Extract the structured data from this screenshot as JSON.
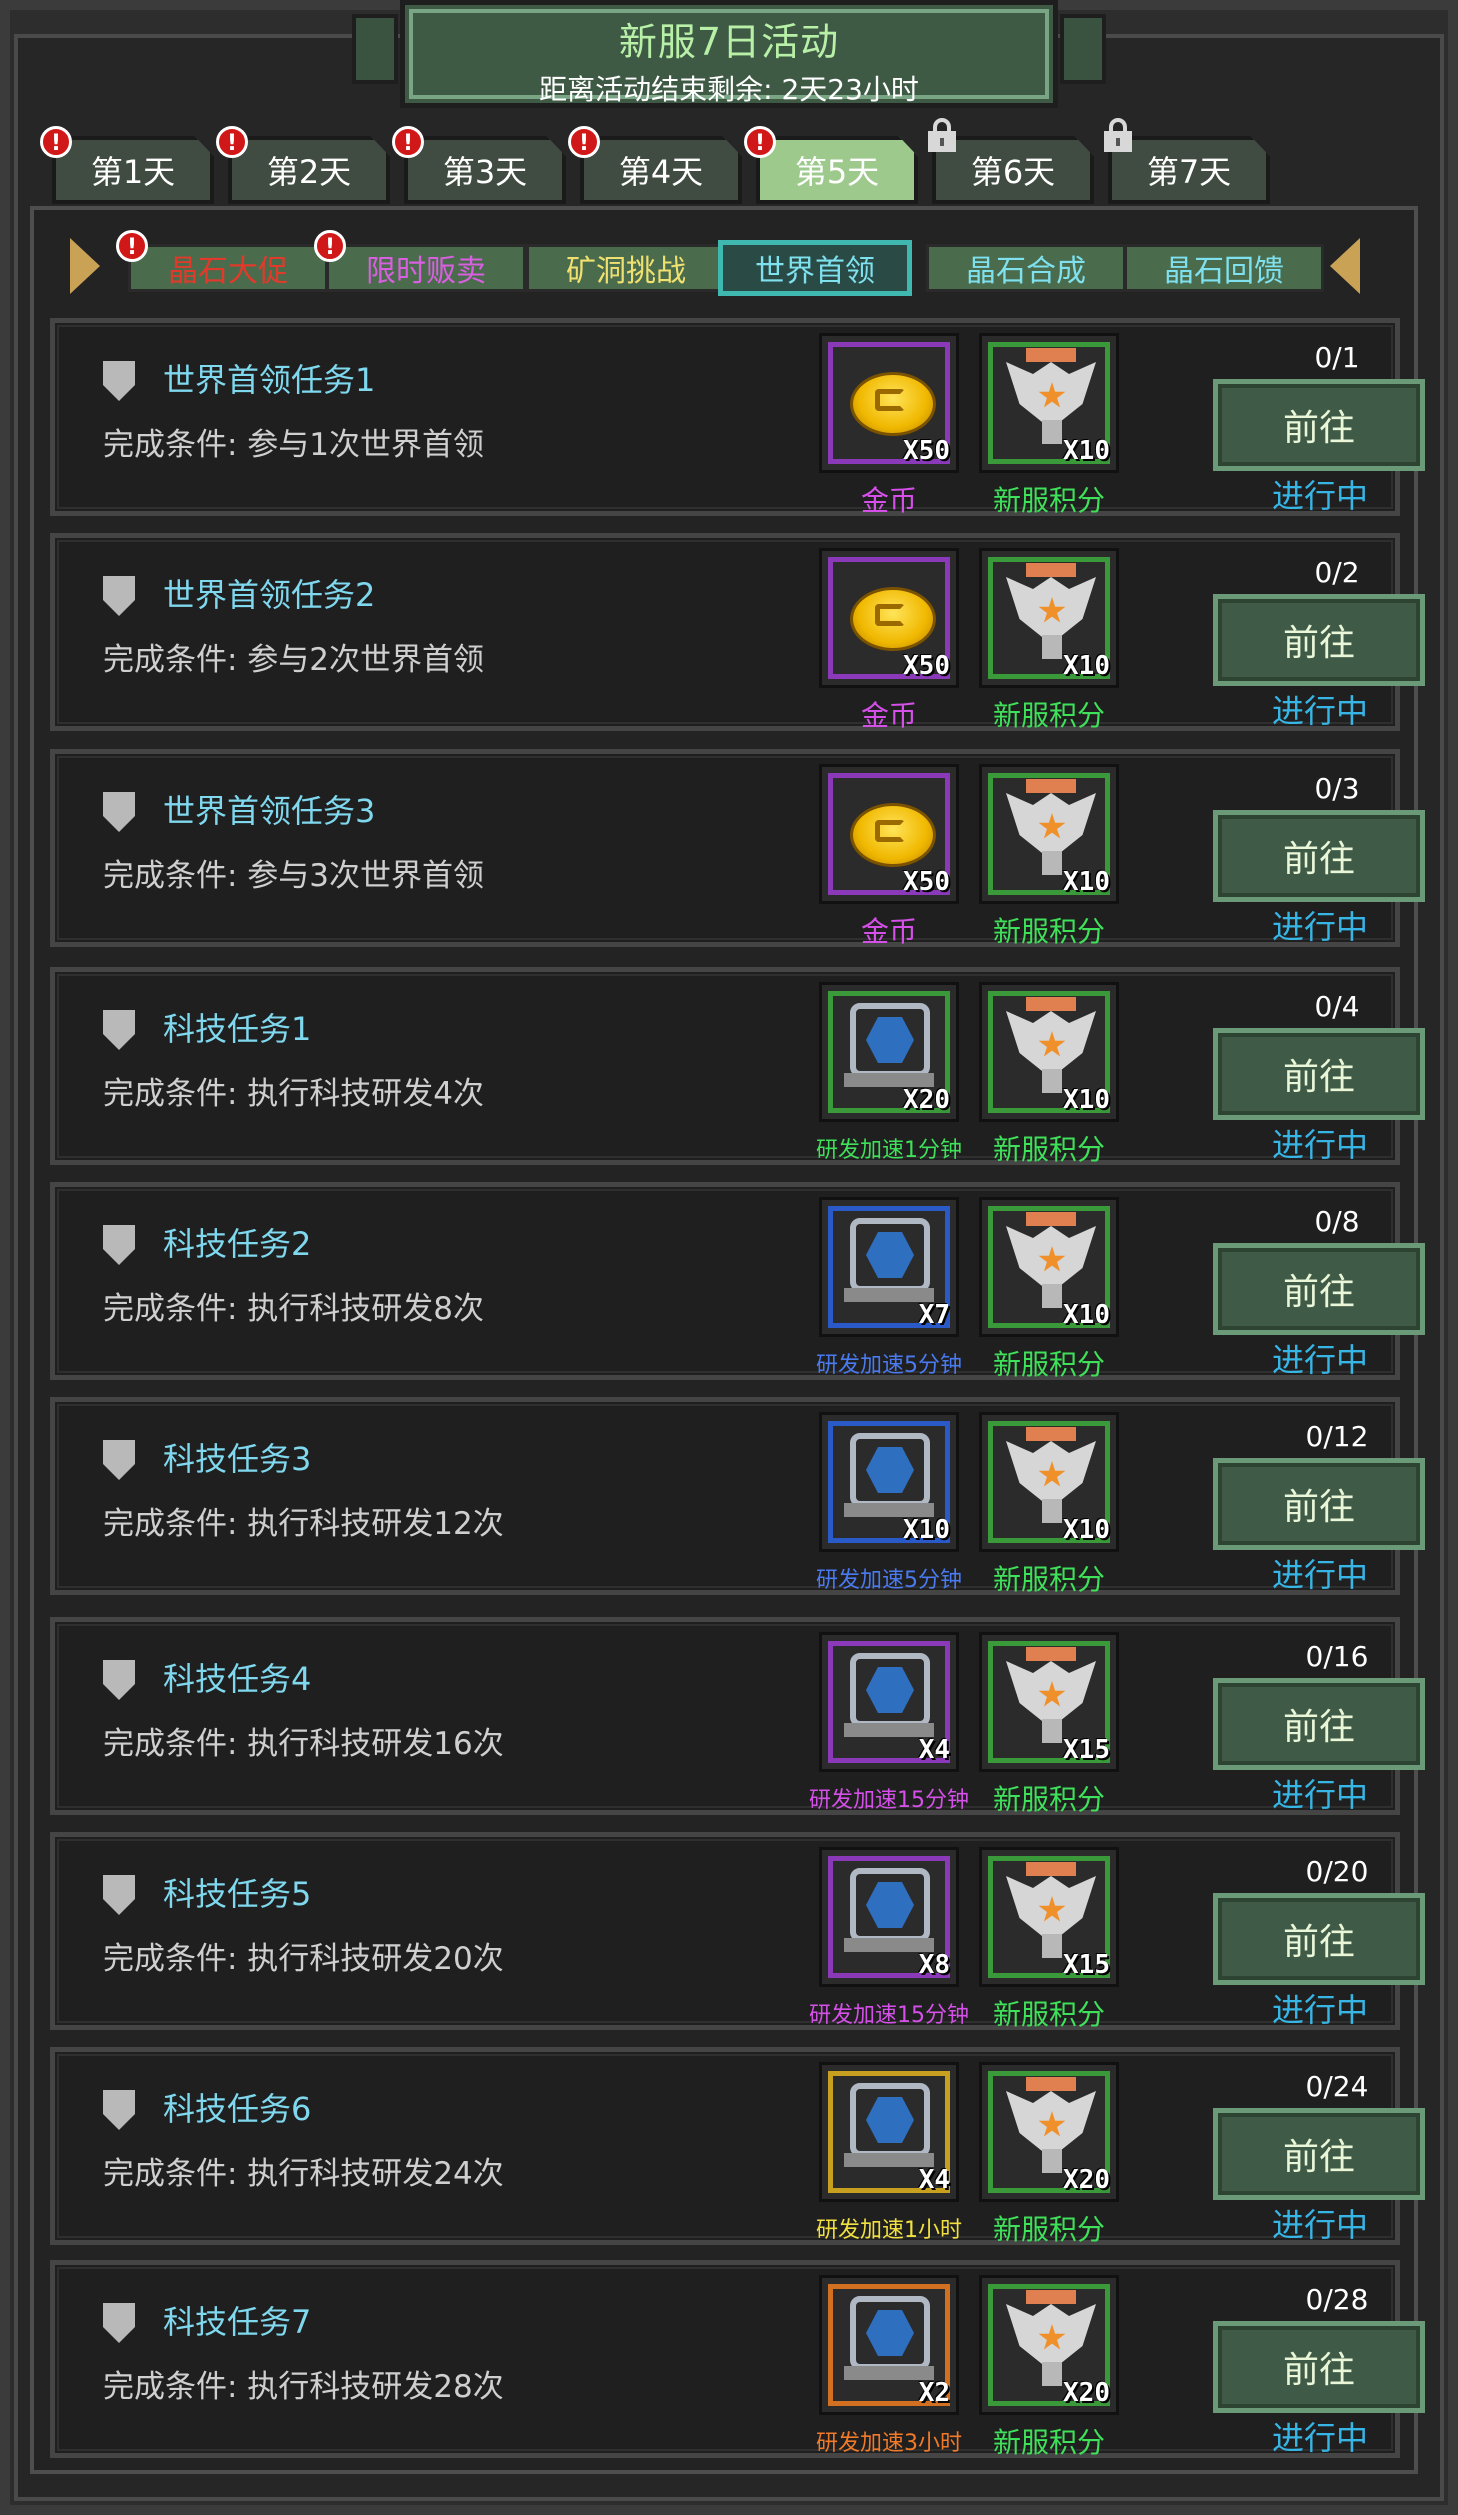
{
  "banner": {
    "title": "新服7日活动",
    "subtitle": "距离活动结束剩余: 2天23小时"
  },
  "days": [
    {
      "label": "第1天",
      "badge": "!",
      "locked": false,
      "active": false
    },
    {
      "label": "第2天",
      "badge": "!",
      "locked": false,
      "active": false
    },
    {
      "label": "第3天",
      "badge": "!",
      "locked": false,
      "active": false
    },
    {
      "label": "第4天",
      "badge": "!",
      "locked": false,
      "active": false
    },
    {
      "label": "第5天",
      "badge": "!",
      "locked": false,
      "active": true
    },
    {
      "label": "第6天",
      "badge": "",
      "locked": true,
      "active": false
    },
    {
      "label": "第7天",
      "badge": "",
      "locked": true,
      "active": false
    }
  ],
  "categories": [
    {
      "label": "晶石大促",
      "color": "#e23a2a",
      "badge": "!"
    },
    {
      "label": "限时贩卖",
      "color": "#d860e0",
      "badge": "!"
    },
    {
      "label": "矿洞挑战",
      "color": "#f0e070",
      "badge": ""
    },
    {
      "label": "世界首领",
      "color": "#7fe0ee",
      "badge": "",
      "active": true
    },
    {
      "label": "晶石合成",
      "color": "#7fe0ee",
      "badge": ""
    },
    {
      "label": "晶石回馈",
      "color": "#7fe0ee",
      "badge": ""
    }
  ],
  "colors": {
    "coin_name": "#d450e8",
    "points_name": "#3fe05a",
    "green_item_name": "#3fe05a",
    "blue_item_name": "#4a7af0",
    "purple_item_name": "#d450e8",
    "gold_item_name": "#f0e040",
    "orange_item_name": "#f07a2a",
    "status": "#37b6e6"
  },
  "tasks": [
    {
      "title": "世界首领任务1",
      "condition": "完成条件: 参与1次世界首领",
      "progress": "0/1",
      "reward1": {
        "icon": "gold-coin-icon",
        "name": "金币",
        "qty": "X50",
        "rarity": "purple"
      },
      "reward2": {
        "icon": "new-server-points-icon",
        "name": "新服积分",
        "qty": "X10"
      },
      "button": "前往",
      "status": "进行中"
    },
    {
      "title": "世界首领任务2",
      "condition": "完成条件: 参与2次世界首领",
      "progress": "0/2",
      "reward1": {
        "icon": "gold-coin-icon",
        "name": "金币",
        "qty": "X50",
        "rarity": "purple"
      },
      "reward2": {
        "icon": "new-server-points-icon",
        "name": "新服积分",
        "qty": "X10"
      },
      "button": "前往",
      "status": "进行中"
    },
    {
      "title": "世界首领任务3",
      "condition": "完成条件: 参与3次世界首领",
      "progress": "0/3",
      "reward1": {
        "icon": "gold-coin-icon",
        "name": "金币",
        "qty": "X50",
        "rarity": "purple"
      },
      "reward2": {
        "icon": "new-server-points-icon",
        "name": "新服积分",
        "qty": "X10"
      },
      "button": "前往",
      "status": "进行中"
    },
    {
      "title": "科技任务1",
      "condition": "完成条件: 执行科技研发4次",
      "progress": "0/4",
      "reward1": {
        "icon": "research-speedup-icon",
        "name": "研发加速1分钟",
        "qty": "X20",
        "rarity": "green"
      },
      "reward2": {
        "icon": "new-server-points-icon",
        "name": "新服积分",
        "qty": "X10"
      },
      "button": "前往",
      "status": "进行中"
    },
    {
      "title": "科技任务2",
      "condition": "完成条件: 执行科技研发8次",
      "progress": "0/8",
      "reward1": {
        "icon": "research-speedup-icon",
        "name": "研发加速5分钟",
        "qty": "X7",
        "rarity": "blue"
      },
      "reward2": {
        "icon": "new-server-points-icon",
        "name": "新服积分",
        "qty": "X10"
      },
      "button": "前往",
      "status": "进行中"
    },
    {
      "title": "科技任务3",
      "condition": "完成条件: 执行科技研发12次",
      "progress": "0/12",
      "reward1": {
        "icon": "research-speedup-icon",
        "name": "研发加速5分钟",
        "qty": "X10",
        "rarity": "blue"
      },
      "reward2": {
        "icon": "new-server-points-icon",
        "name": "新服积分",
        "qty": "X10"
      },
      "button": "前往",
      "status": "进行中"
    },
    {
      "title": "科技任务4",
      "condition": "完成条件: 执行科技研发16次",
      "progress": "0/16",
      "reward1": {
        "icon": "research-speedup-icon",
        "name": "研发加速15分钟",
        "qty": "X4",
        "rarity": "purple"
      },
      "reward2": {
        "icon": "new-server-points-icon",
        "name": "新服积分",
        "qty": "X15"
      },
      "button": "前往",
      "status": "进行中"
    },
    {
      "title": "科技任务5",
      "condition": "完成条件: 执行科技研发20次",
      "progress": "0/20",
      "reward1": {
        "icon": "research-speedup-icon",
        "name": "研发加速15分钟",
        "qty": "X8",
        "rarity": "purple"
      },
      "reward2": {
        "icon": "new-server-points-icon",
        "name": "新服积分",
        "qty": "X15"
      },
      "button": "前往",
      "status": "进行中"
    },
    {
      "title": "科技任务6",
      "condition": "完成条件: 执行科技研发24次",
      "progress": "0/24",
      "reward1": {
        "icon": "research-speedup-icon",
        "name": "研发加速1小时",
        "qty": "X4",
        "rarity": "gold"
      },
      "reward2": {
        "icon": "new-server-points-icon",
        "name": "新服积分",
        "qty": "X20"
      },
      "button": "前往",
      "status": "进行中"
    },
    {
      "title": "科技任务7",
      "condition": "完成条件: 执行科技研发28次",
      "progress": "0/28",
      "reward1": {
        "icon": "research-speedup-icon",
        "name": "研发加速3小时",
        "qty": "X2",
        "rarity": "orange"
      },
      "reward2": {
        "icon": "new-server-points-icon",
        "name": "新服积分",
        "qty": "X20"
      },
      "button": "前往",
      "status": "进行中"
    }
  ]
}
